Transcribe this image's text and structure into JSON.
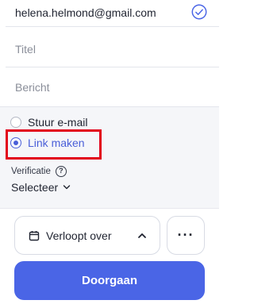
{
  "form": {
    "email_value": "helena.helmond@gmail.com",
    "title_placeholder": "Titel",
    "message_placeholder": "Bericht"
  },
  "options": {
    "send_email_label": "Stuur e-mail",
    "make_link_label": "Link maken",
    "selected": "make_link",
    "verification_label": "Verificatie",
    "verification_value": "Selecteer"
  },
  "footer": {
    "expiry_label": "Verloopt over",
    "more_label": "···",
    "continue_label": "Doorgaan"
  },
  "colors": {
    "accent": "#4a65e6",
    "highlight": "#e2001a"
  }
}
